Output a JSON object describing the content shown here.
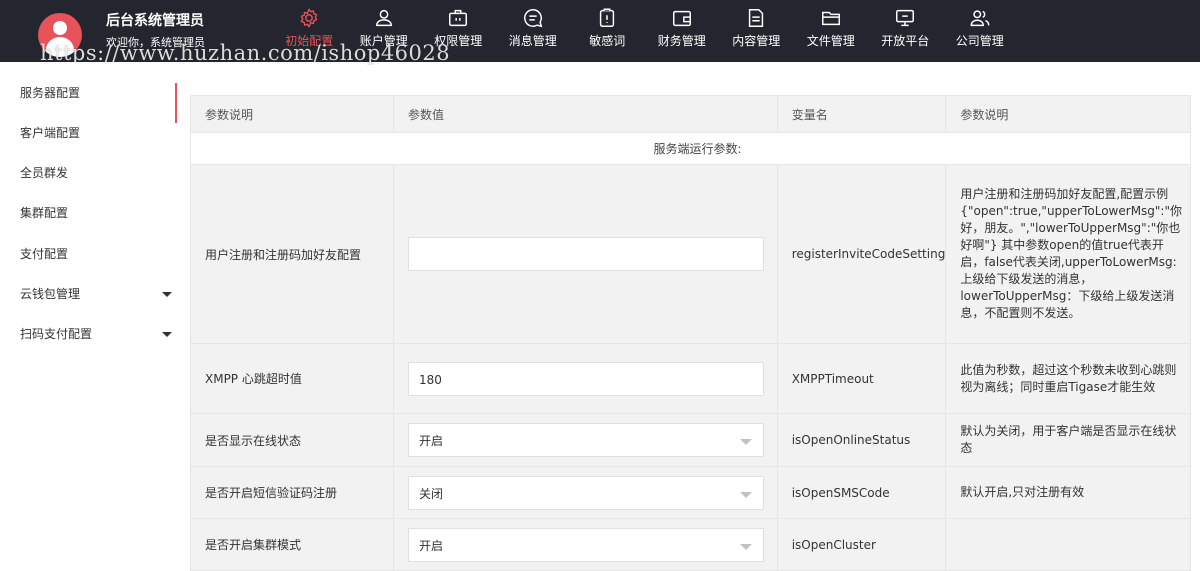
{
  "header": {
    "admin_name": "后台系统管理员",
    "greeting": "欢迎你，系统管理员",
    "accent_color": "#e8525a",
    "nav": [
      {
        "label": "初始配置",
        "icon": "gear-icon",
        "active": true
      },
      {
        "label": "账户管理",
        "icon": "user-icon",
        "active": false
      },
      {
        "label": "权限管理",
        "icon": "briefcase-icon",
        "active": false
      },
      {
        "label": "消息管理",
        "icon": "chat-icon",
        "active": false
      },
      {
        "label": "敏感词",
        "icon": "alert-icon",
        "active": false
      },
      {
        "label": "财务管理",
        "icon": "wallet-icon",
        "active": false
      },
      {
        "label": "内容管理",
        "icon": "document-icon",
        "active": false
      },
      {
        "label": "文件管理",
        "icon": "folder-icon",
        "active": false
      },
      {
        "label": "开放平台",
        "icon": "monitor-icon",
        "active": false
      },
      {
        "label": "公司管理",
        "icon": "users-icon",
        "active": false
      }
    ]
  },
  "watermark": "https://www.huzhan.com/ishop46028",
  "sidebar": {
    "items": [
      {
        "label": "服务器配置",
        "active": true,
        "has_caret": false
      },
      {
        "label": "客户端配置",
        "active": false,
        "has_caret": false
      },
      {
        "label": "全员群发",
        "active": false,
        "has_caret": false
      },
      {
        "label": "集群配置",
        "active": false,
        "has_caret": false
      },
      {
        "label": "支付配置",
        "active": false,
        "has_caret": false
      },
      {
        "label": "云钱包管理",
        "active": false,
        "has_caret": true
      },
      {
        "label": "扫码支付配置",
        "active": false,
        "has_caret": true
      }
    ]
  },
  "table": {
    "headers": [
      "参数说明",
      "参数值",
      "变量名",
      "参数说明"
    ],
    "section_title": "服务端运行参数:",
    "rows": [
      {
        "name": "用户注册和注册码加好友配置",
        "input_type": "text",
        "value": "",
        "var": "registerInviteCodeSetting",
        "desc": "用户注册和注册码加好友配置,配置示例{\"open\":true,\"upperToLowerMsg\":\"你好，朋友。\",\"lowerToUpperMsg\":\"你也好啊\"} 其中参数open的值true代表开启，false代表关闭,upperToLowerMsg:上级给下级发送的消息，lowerToUpperMsg：下级给上级发送消息，不配置则不发送。"
      },
      {
        "name": "XMPP 心跳超时值",
        "input_type": "text",
        "value": "180",
        "var": "XMPPTimeout",
        "desc": "此值为秒数，超过这个秒数未收到心跳则视为离线；同时重启Tigase才能生效"
      },
      {
        "name": "是否显示在线状态",
        "input_type": "select",
        "value": "开启",
        "var": "isOpenOnlineStatus",
        "desc": "默认为关闭，用于客户端是否显示在线状态"
      },
      {
        "name": "是否开启短信验证码注册",
        "input_type": "select",
        "value": "关闭",
        "var": "isOpenSMSCode",
        "desc": "默认开启,只对注册有效"
      },
      {
        "name": "是否开启集群模式",
        "input_type": "select",
        "value": "开启",
        "var": "isOpenCluster",
        "desc": ""
      }
    ]
  }
}
